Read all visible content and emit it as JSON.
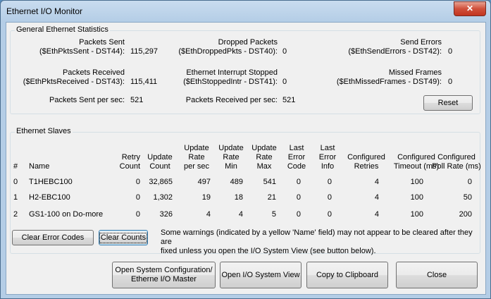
{
  "window": {
    "title": "Ethernet I/O Monitor",
    "close_glyph": "✕"
  },
  "stats": {
    "group_title": "General Ethernet Statistics",
    "packets_sent": {
      "label1": "Packets Sent",
      "label2": "($EthPktsSent - DST44):",
      "value": "115,297"
    },
    "dropped_packets": {
      "label1": "Dropped Packets",
      "label2": "($EthDroppedPkts - DST40):",
      "value": "0"
    },
    "send_errors": {
      "label1": "Send Errors",
      "label2": "($EthSendErrors - DST42):",
      "value": "0"
    },
    "packets_received": {
      "label1": "Packets Received",
      "label2": "($EthPktsReceived - DST43):",
      "value": "115,411"
    },
    "interrupt_stopped": {
      "label1": "Ethernet Interrupt Stopped",
      "label2": "($EthStoppedIntr - DST41):",
      "value": "0"
    },
    "missed_frames": {
      "label1": "Missed Frames",
      "label2": "($EthMissedFrames - DST49):",
      "value": "0"
    },
    "sent_per_sec": {
      "label": "Packets Sent per sec:",
      "value": "521"
    },
    "received_per_sec": {
      "label": "Packets Received per sec:",
      "value": "521"
    },
    "reset_label": "Reset"
  },
  "slaves": {
    "group_title": "Ethernet Slaves",
    "headers": {
      "num": "#",
      "name": "Name",
      "retry": [
        "Retry",
        "Count"
      ],
      "update": [
        "Update",
        "Count"
      ],
      "rate_sec": [
        "Update",
        "Rate",
        "per sec"
      ],
      "rate_min": [
        "Update",
        "Rate",
        "Min"
      ],
      "rate_max": [
        "Update",
        "Rate",
        "Max"
      ],
      "err_code": [
        "Last",
        "Error",
        "Code"
      ],
      "err_info": [
        "Last",
        "Error",
        "Info"
      ],
      "cfg_retries": [
        "Configured",
        "Retries"
      ],
      "cfg_timeout": [
        "Configured",
        "Timeout (ms)"
      ],
      "cfg_poll": [
        "Configured",
        "Poll Rate (ms)"
      ]
    },
    "rows": [
      {
        "num": "0",
        "name": "T1HEBC100",
        "retry": "0",
        "update": "32,865",
        "rate_sec": "497",
        "rate_min": "489",
        "rate_max": "541",
        "err_code": "0",
        "err_info": "0",
        "cfg_retries": "4",
        "cfg_timeout": "100",
        "cfg_poll": "0"
      },
      {
        "num": "1",
        "name": "H2-EBC100",
        "retry": "0",
        "update": "1,302",
        "rate_sec": "19",
        "rate_min": "18",
        "rate_max": "21",
        "err_code": "0",
        "err_info": "0",
        "cfg_retries": "4",
        "cfg_timeout": "100",
        "cfg_poll": "50"
      },
      {
        "num": "2",
        "name": "GS1-100 on Do-more",
        "retry": "0",
        "update": "326",
        "rate_sec": "4",
        "rate_min": "4",
        "rate_max": "5",
        "err_code": "0",
        "err_info": "0",
        "cfg_retries": "4",
        "cfg_timeout": "100",
        "cfg_poll": "200"
      }
    ],
    "clear_error_codes_label": "Clear Error Codes",
    "clear_counts_label": "Clear Counts",
    "note_line1": "Some warnings (indicated by a yellow 'Name' field) may not appear to be cleared after they are",
    "note_line2": "fixed unless you open the I/O System View (see button below)."
  },
  "footer": {
    "open_config_line1": "Open System Configuration/",
    "open_config_line2": "Etherne I/O Master",
    "open_io_view": "Open I/O System View",
    "copy_clipboard": "Copy to Clipboard",
    "close": "Close"
  }
}
